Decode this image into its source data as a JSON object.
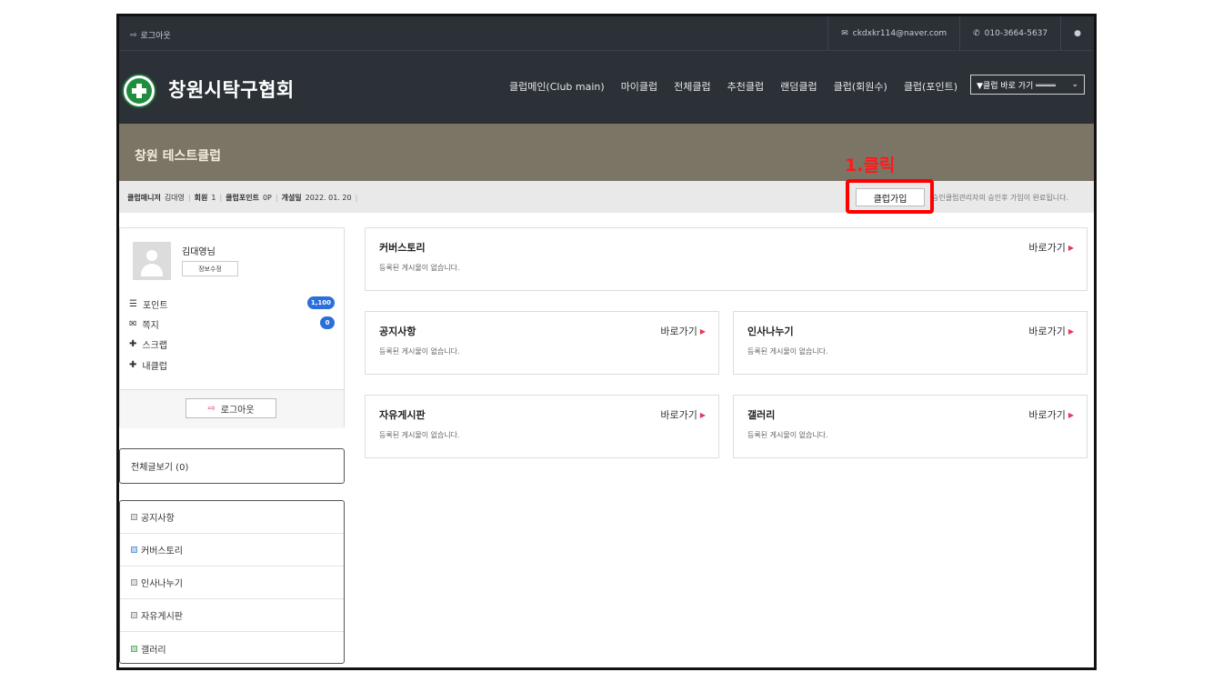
{
  "topbar": {
    "logout_label": "로그아웃",
    "email": "ckdxkr114@naver.com",
    "phone": "010-3664-5637"
  },
  "header": {
    "site_title": "창원시탁구협회",
    "nav": [
      "클럽메인(Club main)",
      "마이클럽",
      "전체클럽",
      "추천클럽",
      "랜덤클럽",
      "클럽(회원수)",
      "클럽(포인트)"
    ],
    "club_select": "▼클럽 바로 가기 ════"
  },
  "club": {
    "name": "창원 테스트클럽",
    "manager_label": "클럽매니저",
    "manager_name": "김대영",
    "members_label": "회원",
    "members_value": "1",
    "points_label": "클럽포인트",
    "points_value": "0P",
    "opened_label": "개설일",
    "opened_value": "2022. 01. 20",
    "join_button": "클럽가입",
    "join_note": "승인클럽관리자의 승인후 가입이 완료됩니다.",
    "annotation": "1.클릭"
  },
  "profile": {
    "name": "김대영님",
    "edit_button": "정보수정",
    "points_label": "포인트",
    "points_badge": "1,100",
    "messages_label": "쪽지",
    "messages_badge": "0",
    "scrap_label": "스크랩",
    "myclub_label": "내클럽",
    "logout_button": "로그아웃"
  },
  "sidebar": {
    "all_posts": "전체글보기 (0)",
    "boards": [
      "공지사항",
      "커버스토리",
      "인사나누기",
      "자유게시판",
      "갤러리"
    ]
  },
  "panels": {
    "cover": {
      "title": "커버스토리",
      "empty": "등록된 게시물이 없습니다.",
      "link": "바로가기"
    },
    "notice": {
      "title": "공지사항",
      "empty": "등록된 게시물이 없습니다.",
      "link": "바로가기"
    },
    "greet": {
      "title": "인사나누기",
      "empty": "등록된 게시물이 없습니다.",
      "link": "바로가기"
    },
    "free": {
      "title": "자유게시판",
      "empty": "등록된 게시물이 없습니다.",
      "link": "바로가기"
    },
    "gallery": {
      "title": "갤러리",
      "empty": "등록된 게시물이 없습니다.",
      "link": "바로가기"
    }
  },
  "colors": {
    "header_bg": "#2b3137",
    "banner_bg": "#7b7566",
    "highlight": "#ff0000",
    "badge": "#2a6fdb",
    "link_arrow": "#e8365d"
  }
}
